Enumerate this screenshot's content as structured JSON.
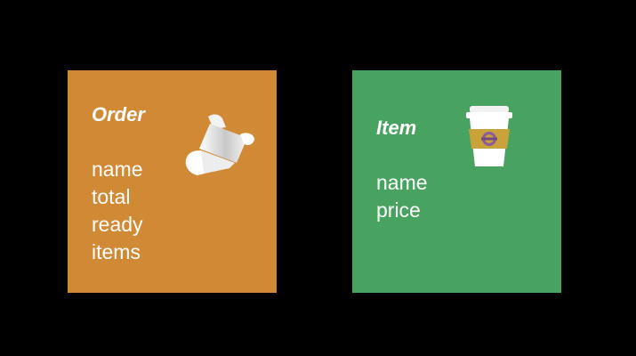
{
  "background": "#000000",
  "cards": [
    {
      "title": "Order",
      "color": "#d08a35",
      "icon": "receipt-icon",
      "fields": [
        "name",
        "total",
        "ready",
        "items"
      ]
    },
    {
      "title": "Item",
      "color": "#47a35f",
      "icon": "coffee-cup-icon",
      "fields": [
        "name",
        "price"
      ]
    }
  ]
}
